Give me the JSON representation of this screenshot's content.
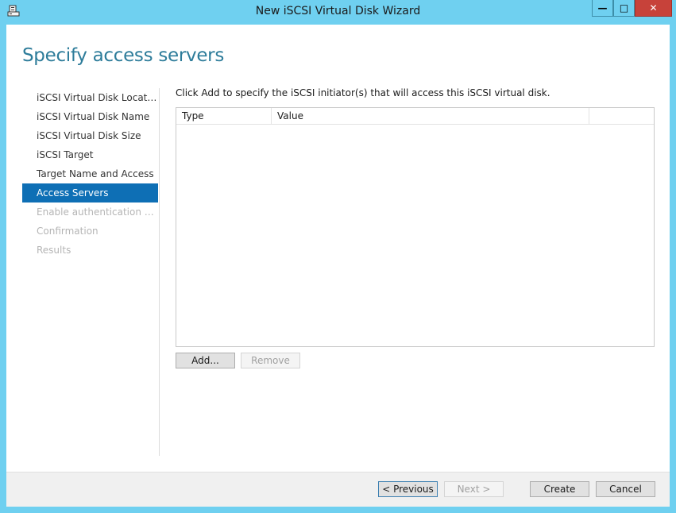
{
  "window": {
    "title": "New iSCSI Virtual Disk Wizard",
    "controls": {
      "minimize": "—",
      "maximize": "□",
      "close": "✕"
    }
  },
  "page": {
    "heading": "Specify access servers"
  },
  "nav": {
    "items": [
      {
        "label": "iSCSI Virtual Disk Location",
        "state": "normal"
      },
      {
        "label": "iSCSI Virtual Disk Name",
        "state": "normal"
      },
      {
        "label": "iSCSI Virtual Disk Size",
        "state": "normal"
      },
      {
        "label": "iSCSI Target",
        "state": "normal"
      },
      {
        "label": "Target Name and Access",
        "state": "normal"
      },
      {
        "label": "Access Servers",
        "state": "active"
      },
      {
        "label": "Enable authentication ser...",
        "state": "disabled"
      },
      {
        "label": "Confirmation",
        "state": "disabled"
      },
      {
        "label": "Results",
        "state": "disabled"
      }
    ]
  },
  "content": {
    "instruction": "Click Add to specify the iSCSI initiator(s) that will access this iSCSI virtual disk.",
    "table": {
      "columns": [
        "Type",
        "Value",
        ""
      ],
      "rows": []
    },
    "add_label": "Add...",
    "remove_label": "Remove"
  },
  "footer": {
    "previous_label": "< Previous",
    "next_label": "Next >",
    "create_label": "Create",
    "cancel_label": "Cancel"
  },
  "icons": {
    "app": "server-wizard-icon"
  },
  "colors": {
    "title_bar": "#6fd0f0",
    "accent": "#0e6fb5",
    "heading": "#2d7c9a",
    "close_button": "#c7423a"
  }
}
